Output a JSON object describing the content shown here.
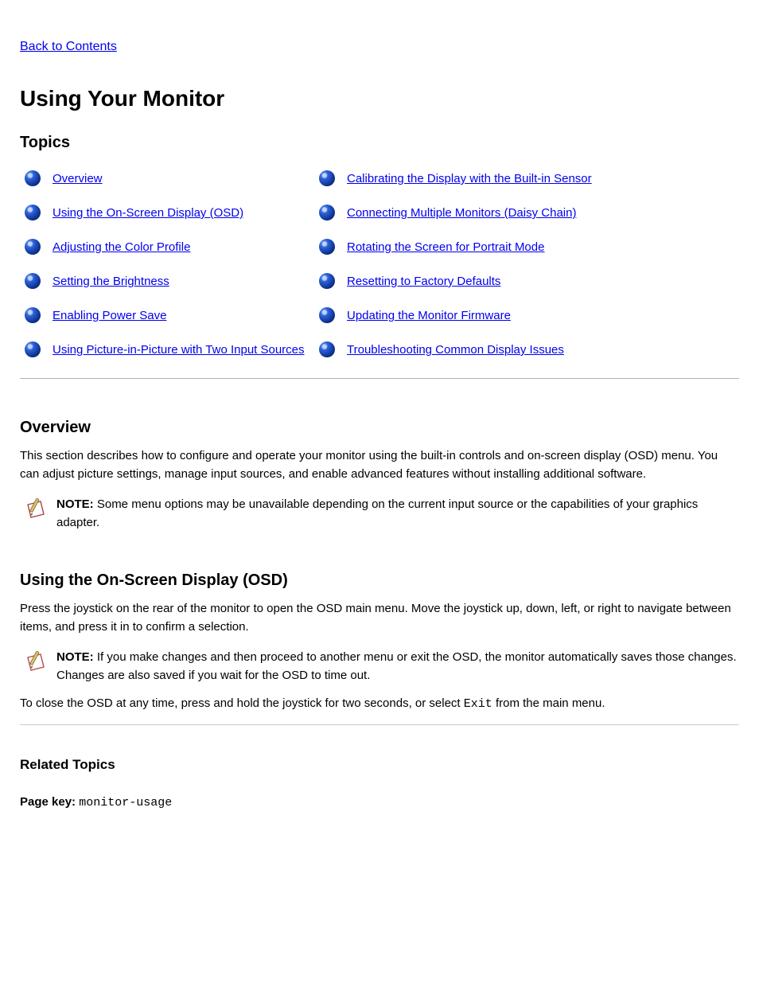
{
  "back_link": "Back to Contents",
  "page_title": "Using Your Monitor",
  "topics_heading": "Topics",
  "topics": {
    "left": [
      "Overview",
      "Using the On-Screen Display (OSD)",
      "Adjusting the Color Profile",
      "Setting the Brightness",
      "Enabling Power Save",
      "Using Picture-in-Picture with Two Input Sources"
    ],
    "right": [
      "Calibrating the Display with the Built-in Sensor",
      "Connecting Multiple Monitors (Daisy Chain)",
      "Rotating the Screen for Portrait Mode",
      "Resetting to Factory Defaults",
      "Updating the Monitor Firmware",
      "Troubleshooting Common Display Issues"
    ]
  },
  "overview": {
    "heading": "Overview",
    "body": "This section describes how to configure and operate your monitor using the built-in controls and on-screen display (OSD) menu. You can adjust picture settings, manage input sources, and enable advanced features without installing additional software."
  },
  "notes": [
    {
      "label": "NOTE:",
      "text": "Some menu options may be unavailable depending on the current input source or the capabilities of your graphics adapter."
    },
    {
      "label": "NOTE:",
      "text": "If you make changes and then proceed to another menu or exit the OSD, the monitor automatically saves those changes. Changes are also saved if you wait for the OSD to time out."
    }
  ],
  "osd": {
    "heading": "Using the On-Screen Display (OSD)",
    "body_1": "Press the joystick on the rear of the monitor to open the OSD main menu. Move the joystick up, down, left, or right to navigate between items, and press it in to confirm a selection.",
    "body_2": "To close the OSD at any time, press and hold the joystick for two seconds, or select ",
    "exit_item": "Exit",
    "body_2_tail": " from the main menu."
  },
  "related_heading": "Related Topics",
  "pagekey": {
    "label": "Page key:",
    "value": "monitor-usage"
  }
}
